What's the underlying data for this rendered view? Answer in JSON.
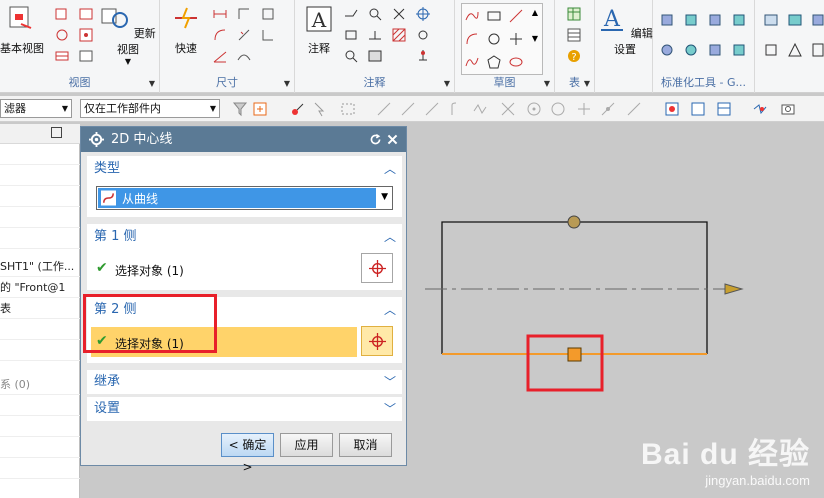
{
  "ribbon": {
    "view": {
      "base_view": "基本视图",
      "update_view": "更新视图",
      "label": "视图"
    },
    "dimension": {
      "quick": "快速",
      "label": "尺寸"
    },
    "annotation": {
      "note": "注释",
      "label": "注释"
    },
    "sketch": {
      "label": "草图"
    },
    "table": {
      "label": "表"
    },
    "edit": {
      "edit_settings": "编辑设置"
    },
    "standard": {
      "label": "标准化工具 - G..."
    }
  },
  "toolbar": {
    "filter_value": "滤器",
    "scope_value": "仅在工作部件内"
  },
  "left_panel": {
    "rows": [
      "SHT1\" (工作...",
      "的 \"Front@1",
      "表",
      "系 (0)"
    ]
  },
  "dialog": {
    "title": "2D 中心线",
    "type": {
      "header": "类型",
      "value": "从曲线"
    },
    "side1": {
      "header": "第 1 侧",
      "status": "选择对象 (1)"
    },
    "side2": {
      "header": "第 2 侧",
      "status": "选择对象 (1)"
    },
    "inherit": {
      "header": "继承"
    },
    "settings": {
      "header": "设置"
    },
    "ok": "< 确定 >",
    "apply": "应用",
    "cancel": "取消"
  },
  "colors": {
    "title_bar": "#5b7a95",
    "highlight": "#ffd36a",
    "accent_blue": "#2a67b0",
    "annotation_red": "#e8202a",
    "selected_line": "#f39a2b"
  },
  "watermark": {
    "brand": "Bai du 经验",
    "url": "jingyan.baidu.com"
  }
}
